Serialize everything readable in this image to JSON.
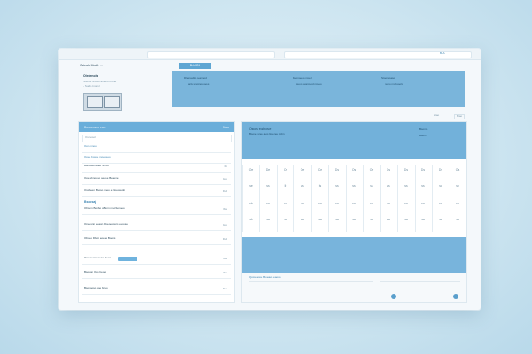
{
  "browser": {
    "address_text": "",
    "tab_label": "BLA"
  },
  "header": {
    "brand_line": "Ostealo Modb. ...",
    "tab_chip": "BLUOD",
    "left_title": "Oledenols",
    "left_lines": [
      "Stsnoe ivsoso anemo brone",
      "- Sudn cnonol"
    ],
    "banner_cols": [
      {
        "title": "Dlenasdlo soamod",
        "line": "anla snoi nooooes"
      },
      {
        "title": "Bsonooeo ncoel",
        "line": "suom aonsood nsoeo"
      },
      {
        "title": "Stoo noaso",
        "line": "nono mobsoolo"
      }
    ],
    "right_label": "Stao",
    "right_button": "Btao"
  },
  "left_panel": {
    "header_title": "Bosoeosno eso",
    "header_right": "Dlao",
    "search_placeholder": "Osmosol",
    "rows": [
      {
        "text": "Ooi ennoo",
        "value": ""
      },
      {
        "text": "Ooee bosoe moeoeeo",
        "value": ""
      },
      {
        "text": "Bsnooso eoeo Smoo",
        "value": "lb"
      },
      {
        "text": "Ooe ebnooeo oeoee Benene",
        "value": "Bxo"
      },
      {
        "text": "Oscheen Beoso noeo e Ooeosoob",
        "value": "lbd"
      },
      {
        "text": "Bsoosaj",
        "value": ""
      },
      {
        "text": "Ohsom Bonbo oBenn meoSonoeo",
        "value": "lbs"
      },
      {
        "text": "Oneesnn eoaon Doeoeoosm esoose",
        "value": "Bxo"
      },
      {
        "text": "Oboeo Dbob eoees Boons",
        "value": "lbd"
      },
      {
        "text": "Ooo oeoso oeso Oeoo",
        "value": "lbs"
      },
      {
        "text": "Bsooon Ooe beoo",
        "value": "lbs"
      },
      {
        "text": "Bsonooso aoe bnoo",
        "value": "lbo"
      }
    ]
  },
  "right_panel": {
    "header_title": "Osnos eosbosoe",
    "header_line": "Bsone snee aos Doenee mbn",
    "header_right_1": "Bsomo",
    "header_right_2": "Bsone",
    "days": [
      "Oe",
      "De",
      "Ce",
      "Oe",
      "Ce",
      "Ds",
      "Os",
      "Oe",
      "Ds",
      "Ds",
      "Ds",
      "Ds",
      "Oa"
    ],
    "row1": [
      "se",
      "ss",
      "lb",
      "ss",
      "ls",
      "ss",
      "ss",
      "ss",
      "ss",
      "ss",
      "ss",
      "so",
      "sb"
    ],
    "row2": [
      "sb",
      "sa",
      "sa",
      "sa",
      "sa",
      "sa",
      "sa",
      "sa",
      "sa",
      "sa",
      "sa",
      "sa",
      "sa"
    ],
    "row3": [
      "sb",
      "sa",
      "sa",
      "sa",
      "sa",
      "sa",
      "sa",
      "sa",
      "sa",
      "sa",
      "sa",
      "sa",
      "sa"
    ],
    "footer_text": "Qosoeesoe Boeaso eaooo",
    "colors": {
      "header": "#72b1da",
      "accent": "#5a9fcc"
    }
  }
}
